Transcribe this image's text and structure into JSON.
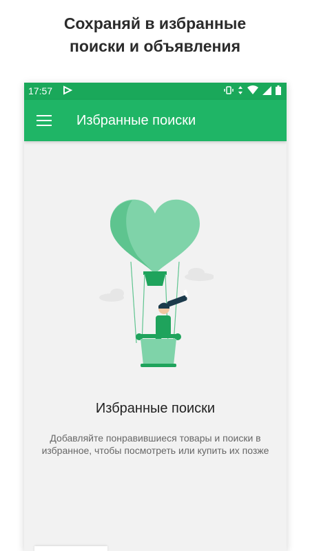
{
  "promo": {
    "line1": "Сохраняй в избранные",
    "line2": "поиски и объявления"
  },
  "statusbar": {
    "time": "17:57"
  },
  "appbar": {
    "title": "Избранные поиски"
  },
  "empty_state": {
    "title": "Избранные поиски",
    "description": "Добавляйте понравившиеся товары и поиски в избранное, чтобы посмотреть или купить их позже"
  },
  "colors": {
    "statusbar": "#1aa85a",
    "appbar": "#1fb566",
    "accent_light": "#7fd3a9",
    "accent_dark": "#1fa35c"
  },
  "icons": [
    "menu-icon",
    "vibrate-icon",
    "wifi-icon",
    "signal-icon",
    "battery-icon",
    "play-icon"
  ]
}
